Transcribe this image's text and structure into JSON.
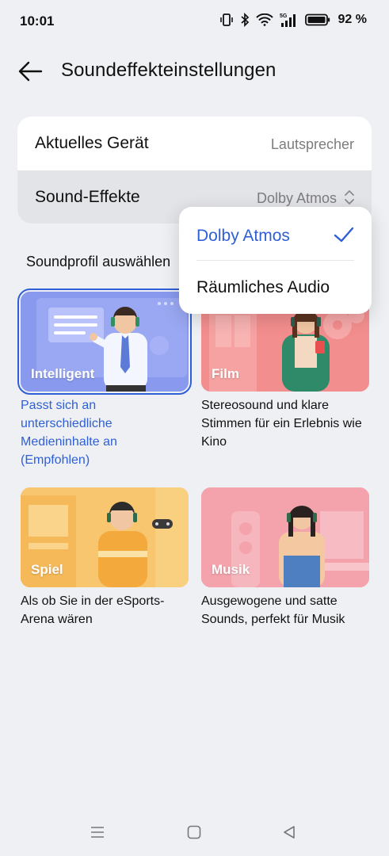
{
  "status_bar": {
    "time": "10:01",
    "battery": "92 %",
    "network": "5G"
  },
  "header": {
    "title": "Soundeffekteinstellungen"
  },
  "settings": {
    "current_device_label": "Aktuelles Gerät",
    "current_device_value": "Lautsprecher",
    "sound_effects_label": "Sound-Effekte",
    "sound_effects_value": "Dolby Atmos"
  },
  "section": {
    "label": "Soundprofil auswählen"
  },
  "profiles": [
    {
      "name": "Intelligent",
      "description": "Passt sich an unterschiedliche Medieninhalte an (Empfohlen)",
      "selected": true
    },
    {
      "name": "Film",
      "description": "Stereosound und klare Stimmen für ein Erlebnis wie Kino",
      "selected": false
    },
    {
      "name": "Spiel",
      "description": "Als ob Sie in der eSports-Arena wären",
      "selected": false
    },
    {
      "name": "Musik",
      "description": "Ausgewogene und satte Sounds, perfekt für Musik",
      "selected": false
    }
  ],
  "dropdown": {
    "options": [
      "Dolby Atmos",
      "Räumliches Audio"
    ],
    "selected": "Dolby Atmos"
  },
  "colors": {
    "accent": "#2e5fd6",
    "background": "#eef0f3",
    "intelligent_tile": "#8a9af0",
    "film_tile": "#f28a8a",
    "game_tile": "#f7c56e",
    "music_tile": "#f3a0aa"
  }
}
